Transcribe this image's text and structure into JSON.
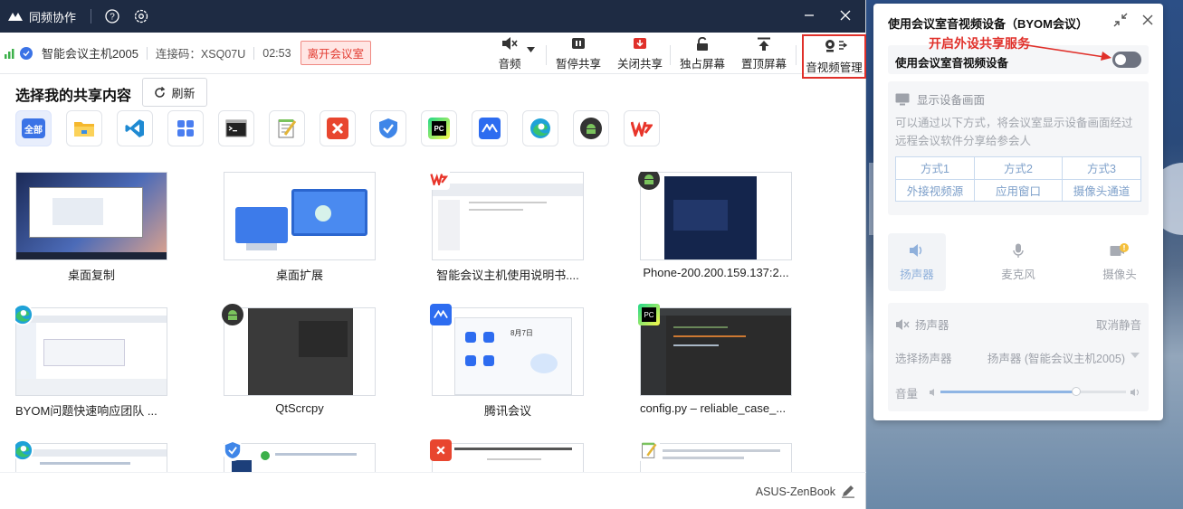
{
  "window": {
    "app_name": "同频协作",
    "device_name": "智能会议主机2005",
    "connect_code": "连接码：XSQ07U",
    "timer": "02:53",
    "leave_label": "离开会议室"
  },
  "toolbar": {
    "audio": "音频",
    "pause_share": "暂停共享",
    "close_share": "关闭共享",
    "exclusive_screen": "独占屏幕",
    "pin_screen": "置顶屏幕",
    "av_manage": "音视频管理"
  },
  "share": {
    "heading": "选择我的共享内容",
    "refresh": "刷新",
    "filter_all": "全部",
    "filter_icons": [
      "folder-icon",
      "vscode-icon",
      "apps-icon",
      "terminal-icon",
      "notepad-icon",
      "xmind-icon",
      "security-icon",
      "pycharm-icon",
      "tencent-meeting-icon",
      "edge-icon",
      "android-icon",
      "wps-icon"
    ],
    "items": [
      {
        "caption": "桌面复制",
        "icon": "desktop-icon"
      },
      {
        "caption": "桌面扩展",
        "icon": "desktop-extend-icon"
      },
      {
        "caption": "智能会议主机使用说明书....",
        "icon": "wps-icon"
      },
      {
        "caption": "Phone-200.200.159.137:2...",
        "icon": "android-icon"
      },
      {
        "caption": "BYOM问题快速响应团队 ...",
        "icon": "edge-icon"
      },
      {
        "caption": "QtScrcpy",
        "icon": "android-icon"
      },
      {
        "caption": "腾讯会议",
        "icon": "tencent-meeting-icon"
      },
      {
        "caption": "config.py – reliable_case_...",
        "icon": "pycharm-icon"
      },
      {
        "caption": "",
        "icon": "edge-icon"
      },
      {
        "caption": "",
        "icon": "security-icon"
      },
      {
        "caption": "",
        "icon": "xmind-icon"
      },
      {
        "caption": "",
        "icon": "notepad-icon"
      }
    ],
    "thumb_texts": {
      "tencent_date": "8月7日"
    }
  },
  "footer": {
    "device": "ASUS-ZenBook"
  },
  "panel": {
    "title": "使用会议室音视频设备（BYOM会议）",
    "annotation": "开启外设共享服务",
    "byom_label": "使用会议室音视频设备",
    "byom_enabled": false,
    "display_title": "显示设备画面",
    "display_desc": "可以通过以下方式，将会议室显示设备画面经过远程会议软件分享给参会人",
    "modes": [
      {
        "name": "方式1",
        "desc": "外接视频源"
      },
      {
        "name": "方式2",
        "desc": "应用窗口"
      },
      {
        "name": "方式3",
        "desc": "摄像头通道"
      }
    ],
    "tabs": {
      "speaker": "扬声器",
      "mic": "麦克风",
      "camera": "摄像头"
    },
    "speaker_section": {
      "title": "扬声器",
      "unmute": "取消静音",
      "select_label": "选择扬声器",
      "selected": "扬声器 (智能会议主机2005)",
      "volume_label": "音量",
      "volume_level": 0.73
    }
  },
  "colors": {
    "titlebar": "#1e2b43",
    "accent": "#3b73e6",
    "danger": "#e0302a"
  }
}
